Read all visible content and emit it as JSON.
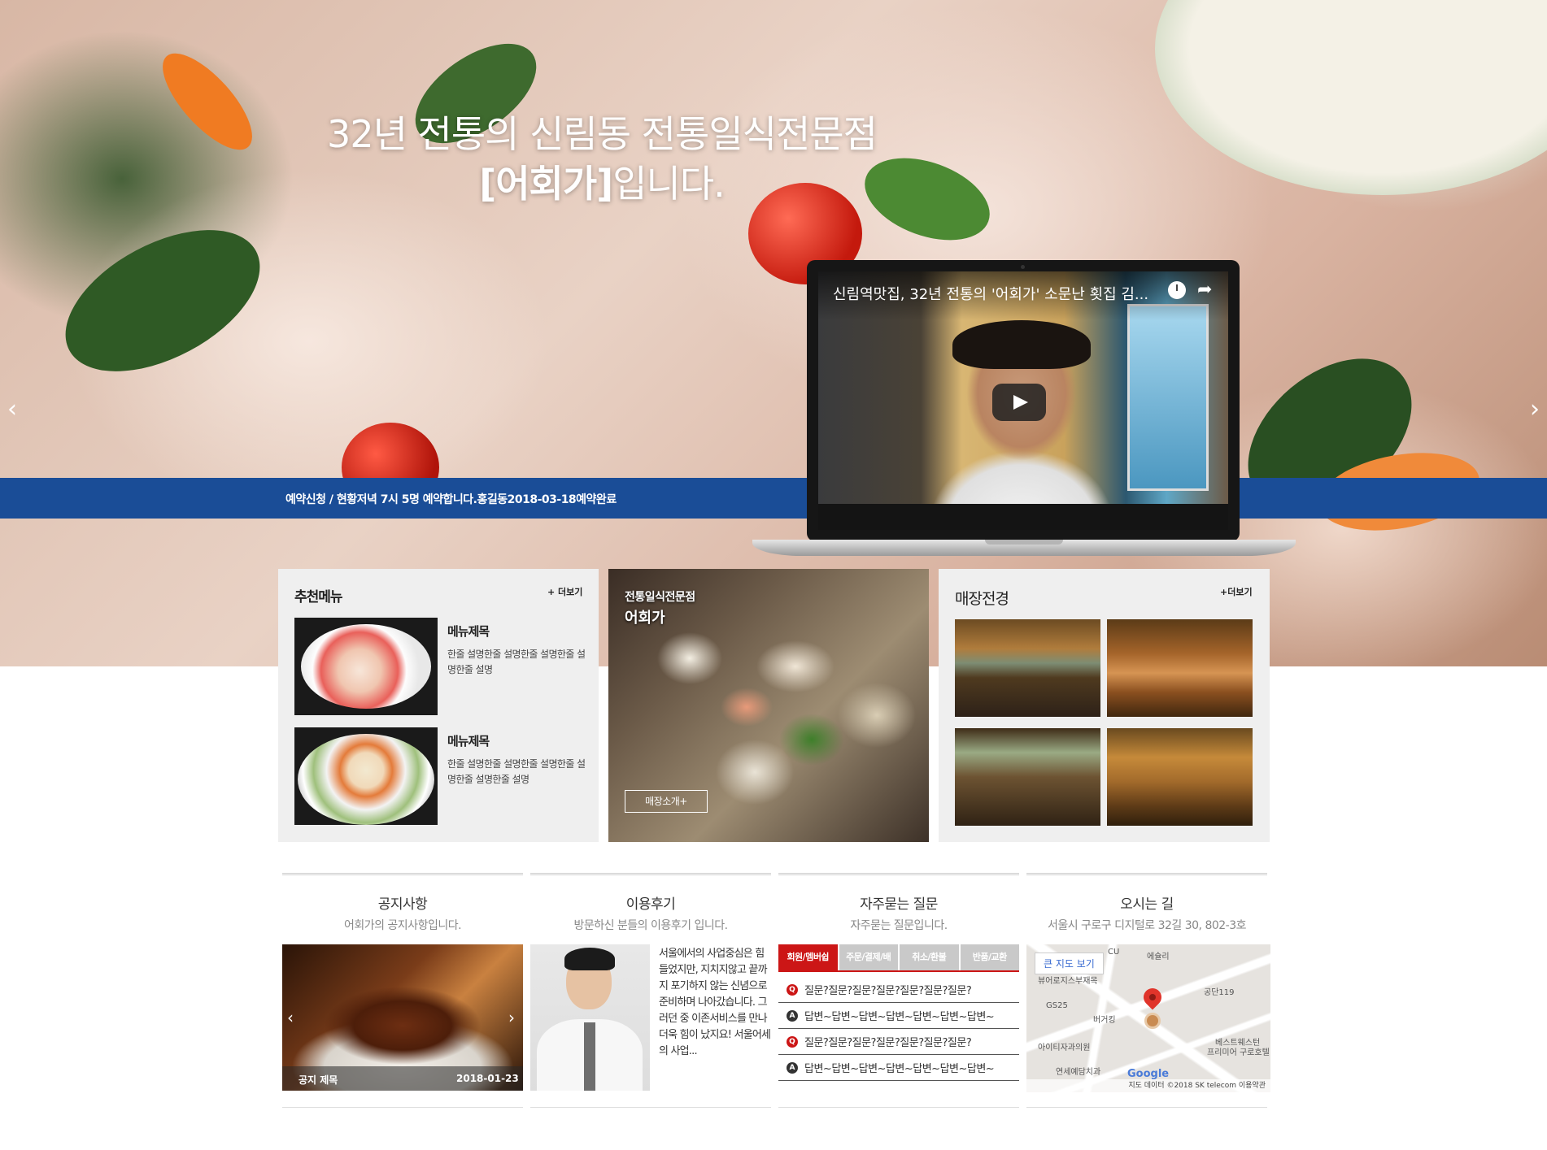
{
  "hero": {
    "title_line1": "32년 전통의 신림동 전통일식전문점",
    "title_line2_bold": "[어회가]",
    "title_line2_rest": "입니다.",
    "ticker": "예약신청 / 현황저녁 7시 5명 예약합니다.홍길동2018-03-18예약완료",
    "prev_arrow": "‹",
    "next_arrow": "›"
  },
  "video": {
    "title": "신림역맛집, 32년 전통의 '어회가' 소문난 횟집 김...",
    "share_icon": "➦"
  },
  "recommend": {
    "heading": "추천메뉴",
    "more": "+ 더보기",
    "items": [
      {
        "name": "메뉴제목",
        "desc": "한줄 설명한줄 설명한줄 설명한줄 설명한줄 설명"
      },
      {
        "name": "메뉴제목",
        "desc": "한줄 설명한줄 설명한줄 설명한줄 설명한줄 설명한줄 설명"
      }
    ]
  },
  "feature": {
    "tag1": "전통일식전문점",
    "tag2": "어회가",
    "button": "매장소개+"
  },
  "store": {
    "heading": "매장전경",
    "more": "+더보기"
  },
  "sections": {
    "notice": {
      "title": "공지사항",
      "subtitle": "어회가의 공지사항입니다.",
      "item_title": "공지 제목",
      "item_date": "2018-01-23",
      "prev": "‹",
      "next": "›"
    },
    "review": {
      "title": "이용후기",
      "subtitle": "방문하신 분들의 이용후기 입니다.",
      "text": "서울에서의 사업중심은 힘들었지만, 지치지않고 끝까지 포기하지 않는 신념으로 준비하며 나아갔습니다. 그러던 중 이존서비스를 만나 더욱 힘이 났지요! 서울어세의 사업..."
    },
    "faq": {
      "title": "자주묻는 질문",
      "subtitle": "자주묻는 질문입니다.",
      "tabs": [
        "회원/멤버쉽",
        "주문/결제/배",
        "취소/환불",
        "반품/교환"
      ],
      "rows": [
        {
          "mark": "Q",
          "text": "질문?질문?질문?질문?질문?질문?질문?"
        },
        {
          "mark": "A",
          "text": "답변~답변~답변~답변~답변~답변~답변~"
        },
        {
          "mark": "Q",
          "text": "질문?질문?질문?질문?질문?질문?질문?"
        },
        {
          "mark": "A",
          "text": "답변~답변~답변~답변~답변~답변~답변~"
        }
      ]
    },
    "directions": {
      "title": "오시는 길",
      "subtitle": "서울시 구로구 디지털로 32길 30, 802-3호",
      "map_button": "큰 지도 보기",
      "map_labels": [
        "에슐리",
        "공단119",
        "GS25",
        "버거킹",
        "아이티자과의원",
        "베스트웨스턴",
        "프리미어 구로호텔",
        "연세예담치과",
        "CU",
        "뷰어로지스부재목"
      ],
      "google": "Google",
      "map_footer": "지도 데이터 ©2018 SK telecom   이용약관"
    }
  },
  "colors": {
    "brand_blue": "#1a4d97",
    "faq_red": "#cc1616"
  }
}
